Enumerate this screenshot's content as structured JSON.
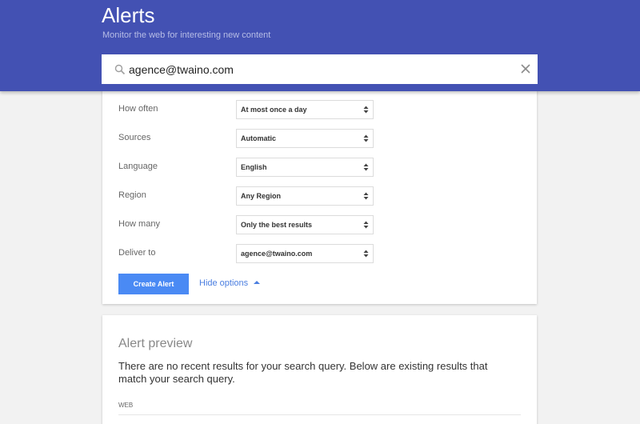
{
  "header": {
    "title": "Alerts",
    "subtitle": "Monitor the web for interesting new content",
    "search": {
      "value": "agence@twaino.com",
      "search_icon": "search-icon",
      "clear_icon": "close-icon"
    },
    "color": "#4351b3"
  },
  "options": {
    "rows": [
      {
        "label": "How often",
        "value": "At most once a day"
      },
      {
        "label": "Sources",
        "value": "Automatic"
      },
      {
        "label": "Language",
        "value": "English"
      },
      {
        "label": "Region",
        "value": "Any Region"
      },
      {
        "label": "How many",
        "value": "Only the best results"
      },
      {
        "label": "Deliver to",
        "value": "agence@twaino.com"
      }
    ],
    "create_button": "Create Alert",
    "hide_options": "Hide options"
  },
  "preview": {
    "title": "Alert preview",
    "message": "There are no recent results for your search query. Below are existing results that match your search query.",
    "section": "WEB"
  }
}
